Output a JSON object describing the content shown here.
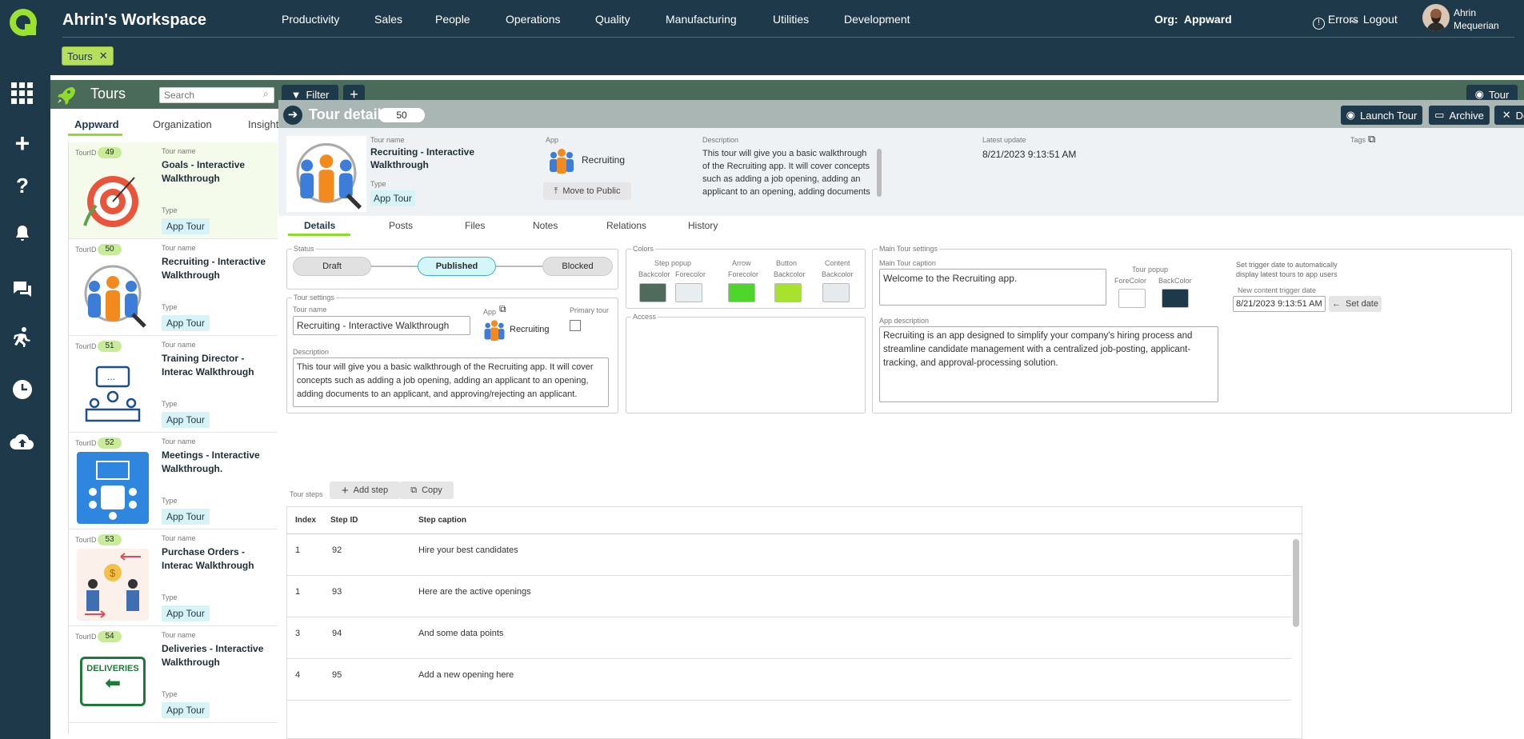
{
  "workspace": {
    "title": "Ahrin's Workspace"
  },
  "nav": [
    "Productivity",
    "Sales",
    "People",
    "Operations",
    "Quality",
    "Manufacturing",
    "Utilities",
    "Development"
  ],
  "org": {
    "label": "Org:",
    "value": "Appward"
  },
  "header": {
    "errors": "Errors",
    "logout": "Logout",
    "user_first": "Ahrin",
    "user_last": "Mequerian"
  },
  "open_chip": {
    "label": "Tours",
    "close": "✕"
  },
  "toolbar": {
    "title": "Tours",
    "search_placeholder": "Search",
    "filter": "Filter",
    "add": "+",
    "tour": "Tour"
  },
  "left_tabs": [
    "Appward",
    "Organization",
    "Insights"
  ],
  "list_labels": {
    "id": "TourID",
    "name": "Tour name",
    "type": "Type"
  },
  "tours": [
    {
      "id": "49",
      "name": "Goals - Interactive Walkthrough",
      "type": "App Tour"
    },
    {
      "id": "50",
      "name": "Recruiting - Interactive Walkthrough",
      "type": "App Tour"
    },
    {
      "id": "51",
      "name": "Training Director - Interac Walkthrough",
      "type": "App Tour"
    },
    {
      "id": "52",
      "name": "Meetings - Interactive Walkthrough.",
      "type": "App Tour"
    },
    {
      "id": "53",
      "name": "Purchase Orders - Interac Walkthrough",
      "type": "App Tour"
    },
    {
      "id": "54",
      "name": "Deliveries - Interactive Walkthrough",
      "type": "App Tour"
    }
  ],
  "deliveries_sign": "DELIVERIES",
  "detail": {
    "title": "Tour details",
    "count": "50",
    "launch": "Launch Tour",
    "archive": "Archive",
    "delete": "Delete",
    "tour_name_label": "Tour name",
    "tour_name": "Recruiting - Interactive Walkthrough",
    "type_label": "Type",
    "type": "App Tour",
    "app_label": "App",
    "app": "Recruiting",
    "move_public": "Move to Public",
    "description_label": "Description",
    "description": "This tour will give you a basic walkthrough of the Recruiting app. It will cover concepts such as adding a job opening, adding an applicant to an opening, adding documents to an applicant, and approving/rejecting an",
    "latest_label": "Latest update",
    "latest": "8/21/2023 9:13:51 AM",
    "tags_label": "Tags"
  },
  "detail_tabs": [
    "Details",
    "Posts",
    "Files",
    "Notes",
    "Relations",
    "History"
  ],
  "status": {
    "legend": "Status",
    "options": [
      "Draft",
      "Published",
      "Blocked"
    ],
    "selected": "Published"
  },
  "colors": {
    "legend": "Colors",
    "step_popup": "Step popup",
    "backcolor": "Backcolor",
    "forecolor": "Forecolor",
    "arrow": "Arrow",
    "arrow_fore": "Forecolor",
    "button": "Button",
    "button_back": "Backcolor",
    "content": "Content",
    "content_back": "Backcolor",
    "swatches": {
      "step_back": "#4f6b5c",
      "step_fore": "#e8eef0",
      "arrow": "#4ed62c",
      "button": "#a6e22e",
      "content": "#e6eaec"
    }
  },
  "settings": {
    "legend": "Tour settings",
    "name_label": "Tour name",
    "name": "Recruiting - Interactive Walkthrough",
    "app_label": "App",
    "app": "Recruiting",
    "primary_label": "Primary tour",
    "desc_label": "Description",
    "desc": "This tour will give you a basic walkthrough of the Recruiting app. It will cover concepts such as adding a job opening, adding an applicant to an opening, adding documents to an applicant, and approving/rejecting an applicant."
  },
  "access": {
    "legend": "Access"
  },
  "main_settings": {
    "legend": "Main Tour settings",
    "caption_label": "Main Tour caption",
    "caption": "Welcome to the Recruiting app.",
    "popup_label": "Tour popup",
    "fore": "ForeColor",
    "back": "BackColor",
    "trigger_note": "Set trigger date to automatically display latest tours to app users",
    "trigger_label": "New content trigger date",
    "trigger_date": "8/21/2023 9:13:51 AM",
    "set_date": "Set date",
    "app_desc_label": "App description",
    "app_desc": "Recruiting is an app designed to simplify your company's hiring process and streamline candidate management with a centralized job-posting, applicant-tracking, and approval-processing solution.",
    "popup_colors": {
      "fore": "#ffffff",
      "back": "#1e3a4a"
    }
  },
  "steps": {
    "label": "Tour steps",
    "add": "Add step",
    "copy": "Copy",
    "headers": [
      "Index",
      "Step ID",
      "Step caption"
    ],
    "rows": [
      {
        "index": "1",
        "id": "92",
        "caption": "Hire your best candidates"
      },
      {
        "index": "1",
        "id": "93",
        "caption": "Here are the active openings"
      },
      {
        "index": "3",
        "id": "94",
        "caption": "And some data points"
      },
      {
        "index": "4",
        "id": "95",
        "caption": "Add a new opening here"
      }
    ]
  }
}
